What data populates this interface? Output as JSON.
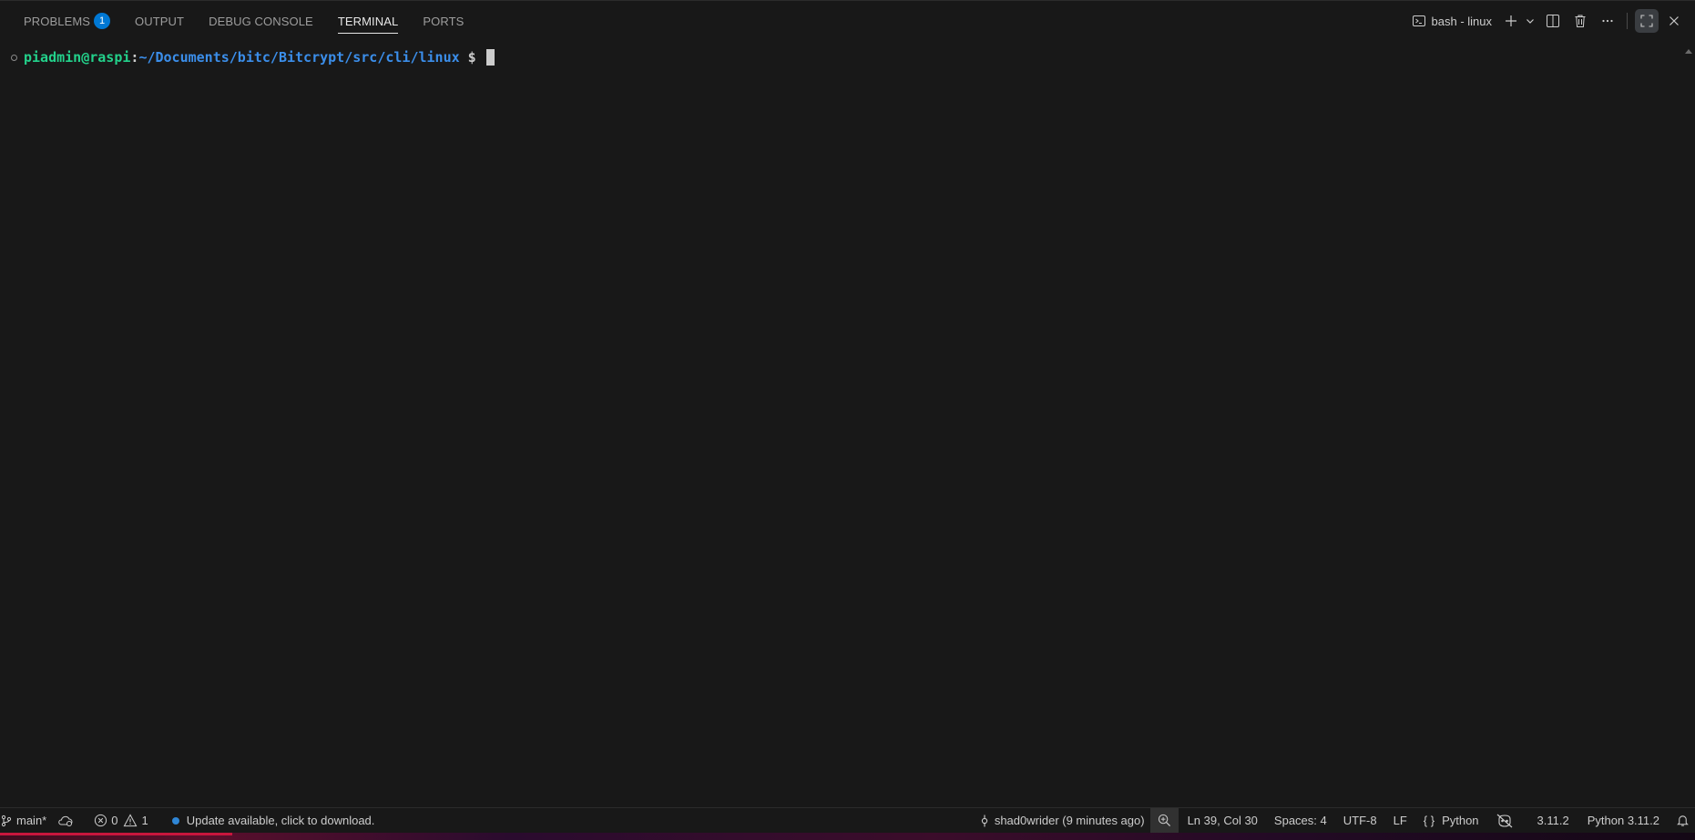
{
  "panel": {
    "tabs": [
      {
        "label": "PROBLEMS",
        "badge": "1"
      },
      {
        "label": "OUTPUT"
      },
      {
        "label": "DEBUG CONSOLE"
      },
      {
        "label": "TERMINAL",
        "active": true
      },
      {
        "label": "PORTS"
      }
    ],
    "terminal_name": "bash - linux",
    "icons": [
      "terminal-icon",
      "plus-icon",
      "chevron-down-icon",
      "split-icon",
      "trash-icon",
      "ellipsis-icon",
      "maximize-icon",
      "close-icon"
    ]
  },
  "terminal": {
    "user_host": "piadmin@raspi",
    "colon": ":",
    "path": "~/Documents/bitc/Bitcrypt/src/cli/linux",
    "dollar": " $ "
  },
  "status_bar": {
    "branch": "main*",
    "errors": "0",
    "warnings": "1",
    "update_message": "Update available, click to download.",
    "blame": "shad0wrider (9 minutes ago)",
    "cursor_position": "Ln 39, Col 30",
    "indentation": "Spaces: 4",
    "encoding": "UTF-8",
    "eol": "LF",
    "language": "Python",
    "language_braces": "{ }",
    "python_version_short": "3.11.2",
    "interpreter": "Python 3.11.2"
  },
  "colors": {
    "background": "#181818",
    "active_tab": "#e7e7e7",
    "badge": "#0078d4",
    "prompt_user": "#23d18b",
    "prompt_path": "#3b8eea"
  }
}
